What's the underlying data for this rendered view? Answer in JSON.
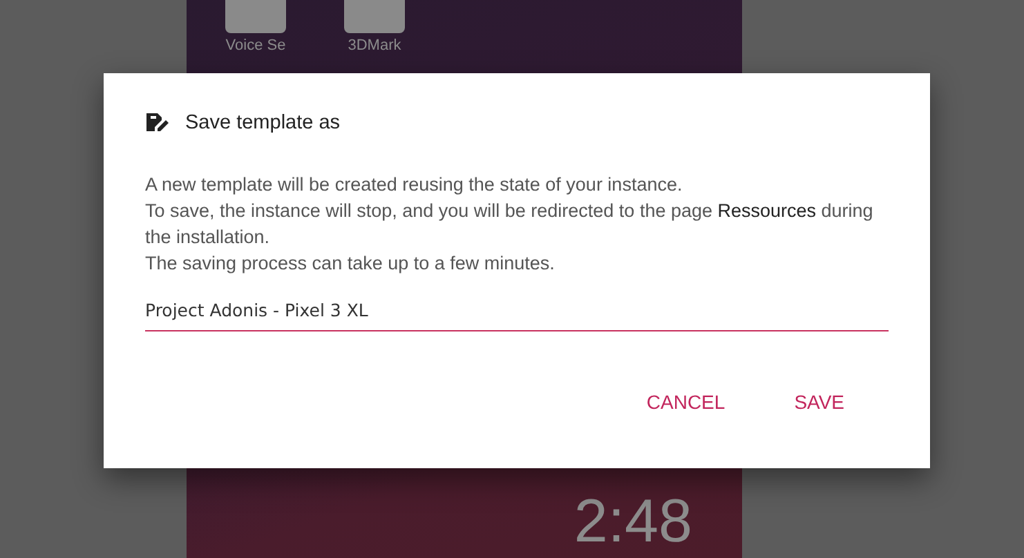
{
  "background": {
    "apps": [
      {
        "label": "Voice Se"
      },
      {
        "label": "3DMark"
      }
    ],
    "clock": "2:48"
  },
  "dialog": {
    "title": "Save template as",
    "paragraphs": [
      "A new template will be created reusing the state of your instance.",
      "To save, the instance will stop, and you will be redirected to the page **Ressources** during the installation.",
      "The saving process can take up to a few minutes."
    ],
    "field": {
      "value": "Project Adonis - Pixel 3 XL"
    },
    "buttons": [
      "CANCEL",
      "SAVE"
    ]
  }
}
